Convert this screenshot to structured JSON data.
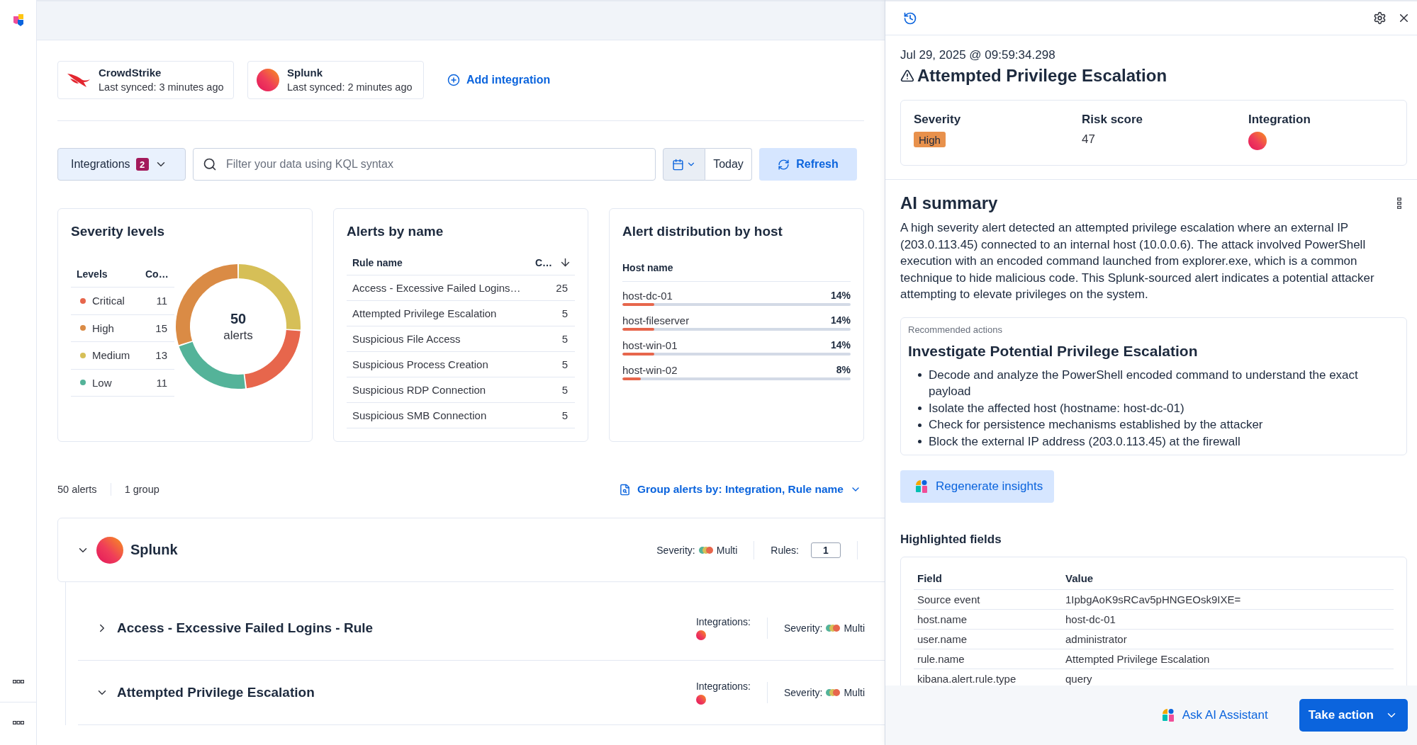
{
  "integrations": [
    {
      "kind": "crowdstrike",
      "name": "CrowdStrike",
      "synced": "Last synced: 3 minutes ago"
    },
    {
      "kind": "splunk",
      "name": "Splunk",
      "synced": "Last synced: 2 minutes ago"
    }
  ],
  "add_integration": "Add integration",
  "filter_bar": {
    "integrations": {
      "label": "Integrations",
      "count": "2"
    },
    "search": {
      "placeholder": "Filter your data using KQL syntax"
    },
    "date_range": "Today",
    "refresh": "Refresh"
  },
  "severity_levels": {
    "title": "Severity levels",
    "columns": [
      "Levels",
      "Co…"
    ],
    "rows": [
      {
        "label": "Critical",
        "count": "11",
        "color": "#e7664c"
      },
      {
        "label": "High",
        "count": "15",
        "color": "#da8b45"
      },
      {
        "label": "Medium",
        "count": "13",
        "color": "#d6bf57"
      },
      {
        "label": "Low",
        "count": "11",
        "color": "#54b399"
      }
    ],
    "total": "50",
    "total_label": "alerts",
    "chart_data": {
      "type": "donut",
      "values": [
        26,
        22,
        22,
        30
      ],
      "colors": [
        "#d6bf57",
        "#e7664c",
        "#54b399",
        "#da8b45"
      ]
    }
  },
  "alerts_by_name": {
    "title": "Alerts by name",
    "columns": [
      "Rule name",
      "C…"
    ],
    "rows": [
      {
        "rule": "Access - Excessive Failed Logins…",
        "count": "25"
      },
      {
        "rule": "Attempted Privilege Escalation",
        "count": "5"
      },
      {
        "rule": "Suspicious File Access",
        "count": "5"
      },
      {
        "rule": "Suspicious Process Creation",
        "count": "5"
      },
      {
        "rule": "Suspicious RDP Connection",
        "count": "5"
      },
      {
        "rule": "Suspicious SMB Connection",
        "count": "5"
      }
    ]
  },
  "host_distribution": {
    "title": "Alert distribution by host",
    "column": "Host name",
    "rows": [
      {
        "host": "host-dc-01",
        "share": "14%",
        "level": 0.14
      },
      {
        "host": "host-fileserver",
        "share": "14%",
        "level": 0.14
      },
      {
        "host": "host-win-01",
        "share": "14%",
        "level": 0.14
      },
      {
        "host": "host-win-02",
        "share": "8%",
        "level": 0.08
      }
    ]
  },
  "alerts_summary": {
    "count": "50 alerts",
    "groups": "1 group",
    "group_by": "Group alerts by: Integration, Rule name"
  },
  "groups": [
    {
      "kind": "splunk",
      "name": "Splunk",
      "expanded": true,
      "severity_label": "Severity:",
      "severity": "Multi",
      "rules_label": "Rules:",
      "rules": "1",
      "children": [
        {
          "name": "Access - Excessive Failed Logins - Rule",
          "expanded": false,
          "integrations_label": "Integrations:",
          "integrations": [
            {
              "kind": "splunk"
            }
          ],
          "severity_label": "Severity:",
          "severity": "Multi"
        },
        {
          "name": "Attempted Privilege Escalation",
          "expanded": true,
          "integrations_label": "Integrations:",
          "integrations": [
            {
              "kind": "splunk"
            }
          ],
          "severity_label": "Severity:",
          "severity": "Multi"
        }
      ]
    }
  ],
  "flyout": {
    "timestamp": "Jul 29, 2025 @ 09:59:34.298",
    "title": "Attempted Privilege Escalation",
    "overview": {
      "severity_label": "Severity",
      "severity": {
        "text": "High",
        "kind": "high"
      },
      "risk_label": "Risk score",
      "risk": "47",
      "integration_label": "Integration",
      "integration": {
        "kind": "splunk"
      }
    },
    "ai_summary": {
      "title": "AI summary",
      "text": "A high severity alert detected an attempted privilege escalation where an external IP (203.0.113.45) connected to an internal host (10.0.0.6). The attack involved PowerShell execution with an encoded command launched from explorer.exe, which is a common technique to hide malicious code. This Splunk-sourced alert indicates a potential attacker attempting to elevate privileges on the system.",
      "recommended": {
        "label": "Recommended actions",
        "title": "Investigate Potential Privilege Escalation",
        "items": [
          "Decode and analyze the PowerShell encoded command to understand the exact payload",
          "Isolate the affected host (hostname: host-dc-01)",
          "Check for persistence mechanisms established by the attacker",
          "Block the external IP address (203.0.113.45) at the firewall"
        ]
      },
      "regenerate": "Regenerate insights"
    },
    "highlighted_fields": {
      "title": "Highlighted fields",
      "columns": [
        "Field",
        "Value"
      ],
      "rows": [
        {
          "field": "Source event",
          "value": "1IpbgAoK9sRCav5pHNGEOsk9IXE="
        },
        {
          "field": "host.name",
          "value": "host-dc-01"
        },
        {
          "field": "user.name",
          "value": "administrator"
        },
        {
          "field": "rule.name",
          "value": "Attempted Privilege Escalation"
        },
        {
          "field": "kibana.alert.rule.type",
          "value": "query"
        }
      ]
    },
    "footer": {
      "ask_ai": "Ask AI Assistant",
      "take_action": "Take action"
    }
  }
}
